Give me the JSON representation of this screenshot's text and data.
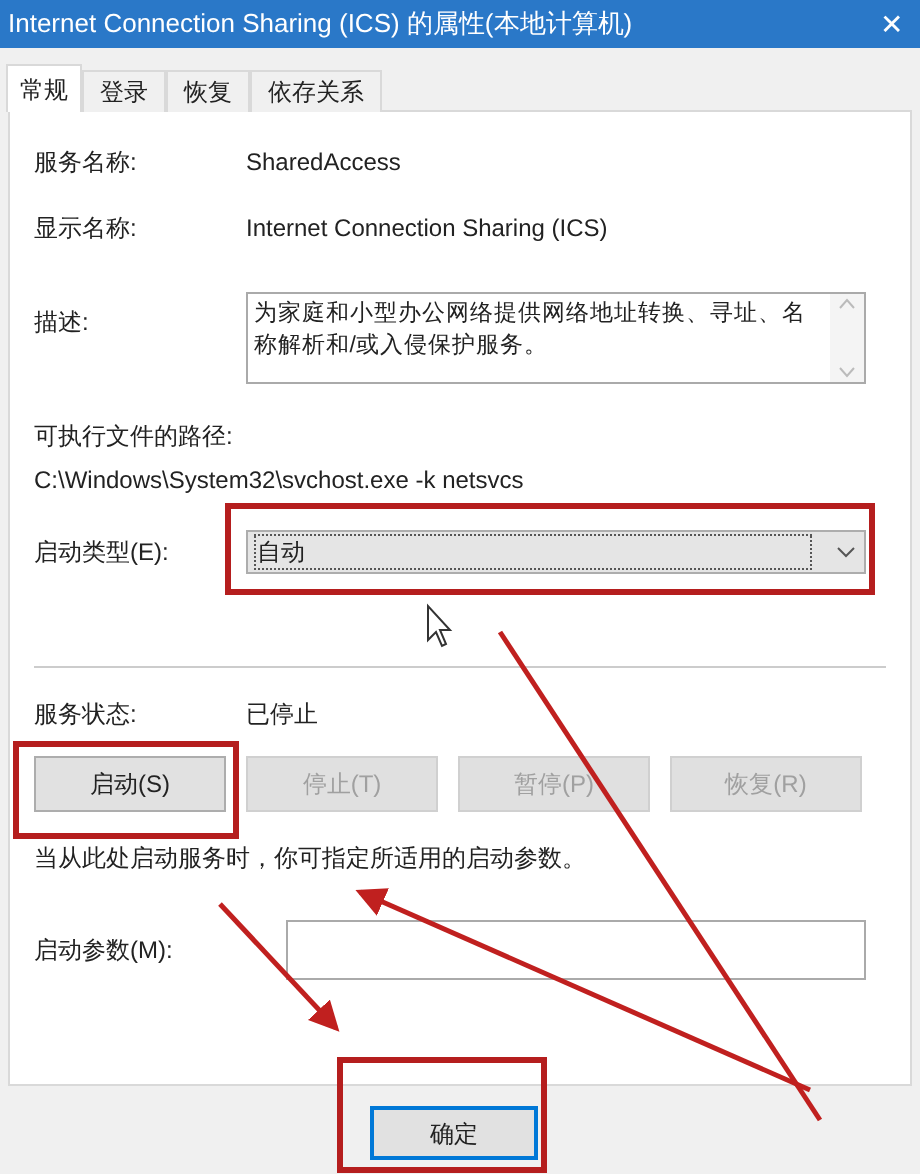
{
  "window": {
    "title": "Internet Connection Sharing (ICS) 的属性(本地计算机)",
    "close": "✕"
  },
  "tabs": [
    {
      "label": "常规",
      "selected": true
    },
    {
      "label": "登录",
      "selected": false
    },
    {
      "label": "恢复",
      "selected": false
    },
    {
      "label": "依存关系",
      "selected": false
    }
  ],
  "fields": [
    {
      "label": "服务名称:",
      "value": "SharedAccess"
    },
    {
      "label": "显示名称:",
      "value": "Internet Connection Sharing (ICS)"
    }
  ],
  "description": {
    "label": "描述:",
    "value": "为家庭和小型办公网络提供网络地址转换、寻址、名称解析和/或入侵保护服务。"
  },
  "path": {
    "label": "可执行文件的路径:",
    "value": "C:\\Windows\\System32\\svchost.exe -k netsvcs"
  },
  "startup_type": {
    "label": "启动类型(E):",
    "value": "自动"
  },
  "service_status": {
    "label": "服务状态:",
    "value": "已停止"
  },
  "service_buttons": [
    {
      "label": "启动(S)",
      "disabled": false
    },
    {
      "label": "停止(T)",
      "disabled": true
    },
    {
      "label": "暂停(P)",
      "disabled": true
    },
    {
      "label": "恢复(R)",
      "disabled": true
    }
  ],
  "hint": "当从此处启动服务时，你可指定所适用的启动参数。",
  "start_params": {
    "label": "启动参数(M):"
  },
  "dialog_buttons": [
    {
      "label": "确定"
    }
  ]
}
